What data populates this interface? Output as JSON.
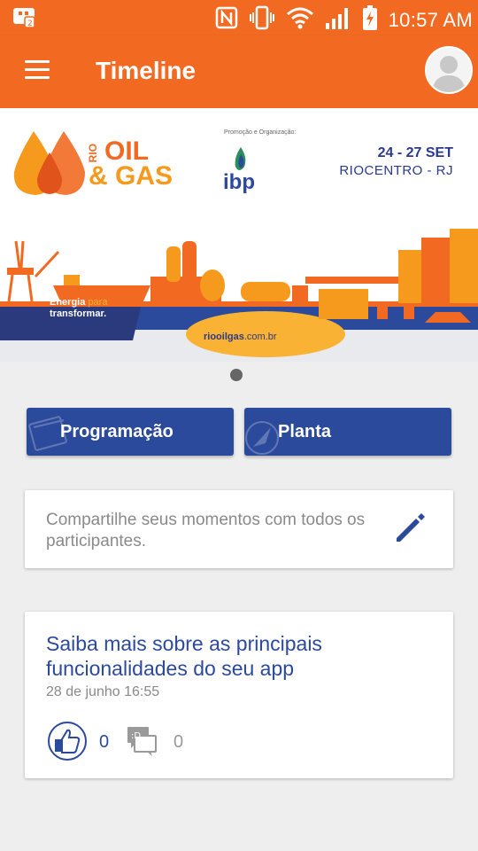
{
  "status_bar": {
    "time": "10:57 AM"
  },
  "app_bar": {
    "title": "Timeline"
  },
  "banner": {
    "logo_rio": "RIO",
    "logo_oil": "OIL",
    "logo_gas": "& GAS",
    "promo_text": "Promoção e Organização:",
    "ibp_text": "ibp",
    "dates": "24 - 27 SET",
    "venue": "RIOCENTRO - RJ",
    "tagline_bold1": "Energia",
    "tagline_light": "para",
    "tagline_bold2": "transformar.",
    "site_bold": "riooilgas",
    "site_light": ".com.br"
  },
  "actions": {
    "programacao": "Programação",
    "planta": "Planta"
  },
  "share": {
    "prompt": "Compartilhe seus momentos com todos os participantes."
  },
  "post": {
    "title": "Saiba mais sobre as principais funcionalidades do seu app",
    "date": "28 de junho 16:55",
    "likes": "0",
    "comments": "0"
  },
  "colors": {
    "primary": "#f26a22",
    "accent": "#2c4a9c",
    "background": "#eeeeee"
  }
}
